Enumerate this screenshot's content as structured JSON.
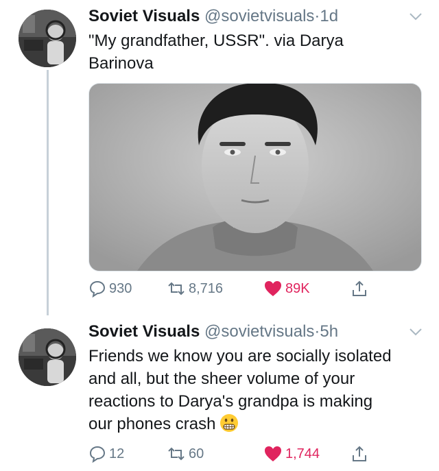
{
  "tweets": [
    {
      "author": {
        "name": "Soviet Visuals",
        "handle": "@sovietvisuals"
      },
      "separator": "·",
      "time": "1d",
      "text_lines": [
        "\"My grandfather, USSR\". via Darya",
        "Barinova"
      ],
      "stats": {
        "replies": "930",
        "retweets": "8,716",
        "likes": "89K"
      }
    },
    {
      "author": {
        "name": "Soviet Visuals",
        "handle": "@sovietvisuals"
      },
      "separator": "·",
      "time": "5h",
      "text_lines": [
        "Friends we know you are socially isolated",
        "and all, but the sheer volume of your",
        "reactions to Darya's grandpa is making",
        "our phones crash"
      ],
      "stats": {
        "replies": "12",
        "retweets": "60",
        "likes": "1,744"
      }
    }
  ],
  "icons": {
    "reply": "speech-bubble-icon",
    "retweet": "retweet-icon",
    "like": "heart-icon",
    "share": "share-icon",
    "menu": "chevron-down-icon",
    "emoji": "grimacing-face-emoji"
  },
  "colors": {
    "text": "#14171a",
    "secondary": "#657786",
    "like_red": "#e0245e",
    "thread_line": "#c7d0d8"
  }
}
